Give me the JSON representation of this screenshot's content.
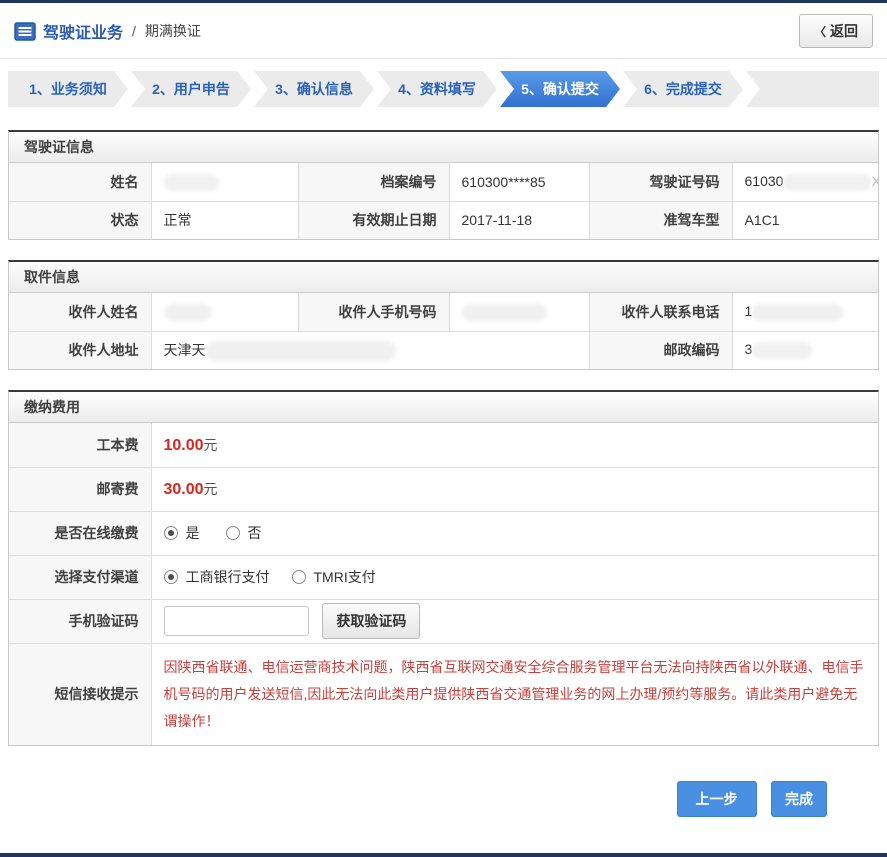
{
  "header": {
    "title": "驾驶证业务",
    "divider": "/",
    "subtitle": "期满换证",
    "back_chevron": "〈",
    "back_label": "返回"
  },
  "steps": {
    "items": [
      {
        "label": "1、业务须知"
      },
      {
        "label": "2、用户申告"
      },
      {
        "label": "3、确认信息"
      },
      {
        "label": "4、资料填写"
      },
      {
        "label": "5、确认提交"
      },
      {
        "label": "6、完成提交"
      }
    ],
    "active_label": "5、确认提交"
  },
  "license_info": {
    "title": "驾驶证信息",
    "name_label": "姓名",
    "name_value": "",
    "archive_label": "档案编号",
    "archive_value": "610300****85",
    "license_no_label": "驾驶证号码",
    "license_no_value": "61030",
    "license_no_tail": "X",
    "status_label": "状态",
    "status_value": "正常",
    "expiry_label": "有效期止日期",
    "expiry_value": "2017-11-18",
    "vehicle_label": "准驾车型",
    "vehicle_value": "A1C1"
  },
  "pickup_info": {
    "title": "取件信息",
    "recipient_name_label": "收件人姓名",
    "recipient_name_value": "",
    "recipient_mobile_label": "收件人手机号码",
    "recipient_mobile_value": "",
    "recipient_tel_label": "收件人联系电话",
    "recipient_tel_value": "1",
    "address_label": "收件人地址",
    "address_value": "天津天",
    "postcode_label": "邮政编码",
    "postcode_value": "3"
  },
  "payment": {
    "title": "缴纳费用",
    "fee_label": "工本费",
    "fee_value": "10.00",
    "fee_unit": "元",
    "postage_label": "邮寄费",
    "postage_value": "30.00",
    "postage_unit": "元",
    "online_label": "是否在线缴费",
    "online_options": [
      {
        "label": "是",
        "checked": true
      },
      {
        "label": "否",
        "checked": false
      }
    ],
    "channel_label": "选择支付渠道",
    "channel_options": [
      {
        "label": "工商银行支付",
        "checked": true
      },
      {
        "label": "TMRI支付",
        "checked": false
      }
    ],
    "sms_code_label": "手机验证码",
    "sms_code_value": "",
    "get_code_button": "获取验证码",
    "sms_tip_label": "短信接收提示",
    "sms_tip_text": "因陕西省联通、电信运营商技术问题，陕西省互联网交通安全综合服务管理平台无法向持陕西省以外联通、电信手机号码的用户发送短信,因此无法向此类用户提供陕西省交通管理业务的网上办理/预约等服务。请此类用户避免无谓操作！"
  },
  "footer": {
    "prev_label": "上一步",
    "finish_label": "完成"
  },
  "colors": {
    "accent_bar": "#22355c",
    "brand_blue": "#2b5cb0",
    "active_step_blue": "#3070d0",
    "button_blue": "#4a90e2",
    "price_red": "#d8261d",
    "notice_red": "#c5413c"
  }
}
